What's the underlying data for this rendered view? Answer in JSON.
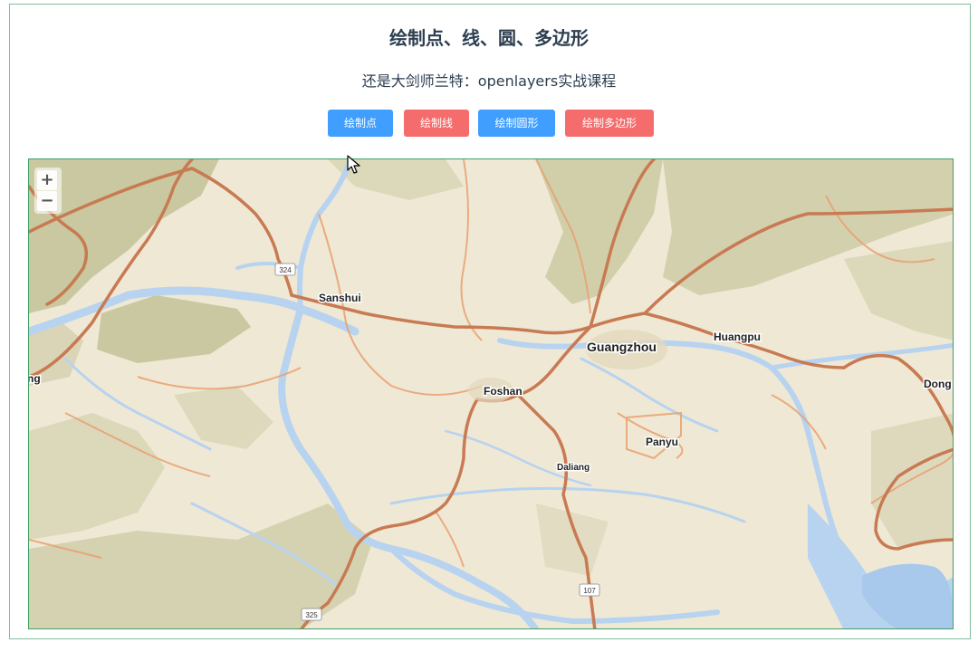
{
  "header": {
    "title": "绘制点、线、圆、多边形",
    "subtitle": "还是大剑师兰特：openlayers实战课程"
  },
  "toolbar": {
    "buttons": [
      {
        "label": "绘制点",
        "color": "#409eff"
      },
      {
        "label": "绘制线",
        "color": "#f56c6c"
      },
      {
        "label": "绘制圆形",
        "color": "#409eff"
      },
      {
        "label": "绘制多边形",
        "color": "#f56c6c"
      }
    ]
  },
  "map": {
    "zoom_in": "+",
    "zoom_out": "−",
    "places": [
      {
        "name": "Sanshui"
      },
      {
        "name": "Guangzhou"
      },
      {
        "name": "Huangpu"
      },
      {
        "name": "Foshan"
      },
      {
        "name": "Panyu"
      },
      {
        "name": "Daliang"
      },
      {
        "name": "Dong"
      },
      {
        "name": "ng"
      }
    ],
    "route_shields": [
      "324",
      "325",
      "107"
    ],
    "colors": {
      "land": "#efe8d5",
      "water": "#b7d3f0",
      "major_road": "#c87a52",
      "minor_road": "#e8a070",
      "hills": "#b9ba8a"
    }
  }
}
